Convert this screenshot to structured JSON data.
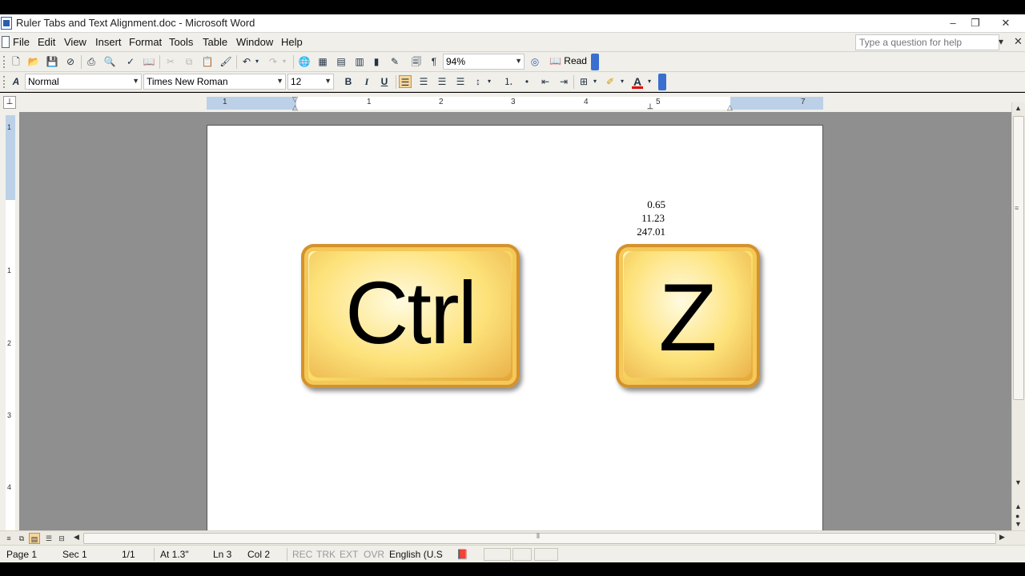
{
  "window": {
    "title": "Ruler Tabs and Text Alignment.doc - Microsoft Word",
    "minimize": "–",
    "maximize": "❐",
    "close": "✕"
  },
  "menubar": {
    "items": [
      "File",
      "Edit",
      "View",
      "Insert",
      "Format",
      "Tools",
      "Table",
      "Window",
      "Help"
    ],
    "help_placeholder": "Type a question for help",
    "help_arrow": "▾",
    "doc_close": "✕"
  },
  "standard_toolbar": {
    "icons": [
      "new-document",
      "open",
      "save",
      "permission",
      "print",
      "print-preview",
      "spelling",
      "research",
      "cut",
      "copy",
      "paste",
      "format-painter",
      "undo",
      "redo",
      "insert-hyperlink",
      "tables-borders",
      "insert-table",
      "insert-excel",
      "columns",
      "drawing",
      "document-map",
      "show-formatting",
      "help"
    ],
    "zoom": "94%",
    "read_label": "Read"
  },
  "formatting_toolbar": {
    "style": "Normal",
    "font": "Times New Roman",
    "size": "12",
    "bold": "B",
    "italic": "I",
    "underline": "U",
    "font_color_letter": "A",
    "font_color": "#e00000"
  },
  "ruler": {
    "horizontal_numbers": [
      "1",
      "1",
      "2",
      "3",
      "4",
      "5",
      "7"
    ],
    "vertical_numbers": [
      "1",
      "1",
      "2",
      "3",
      "4"
    ]
  },
  "document": {
    "numbers": [
      "0.65",
      "11.23",
      "247.01"
    ],
    "keys": {
      "ctrl": "Ctrl",
      "z": "Z"
    }
  },
  "statusbar": {
    "page": "Page 1",
    "sec": "Sec 1",
    "pages": "1/1",
    "at": "At 1.3\"",
    "ln": "Ln 3",
    "col": "Col 2",
    "rec": "REC",
    "trk": "TRK",
    "ext": "EXT",
    "ovr": "OVR",
    "language": "English (U.S"
  },
  "colors": {
    "accent": "#3a6fd0",
    "ruler_blue": "#bcd0e8",
    "key_gold": "#fbe06a"
  }
}
